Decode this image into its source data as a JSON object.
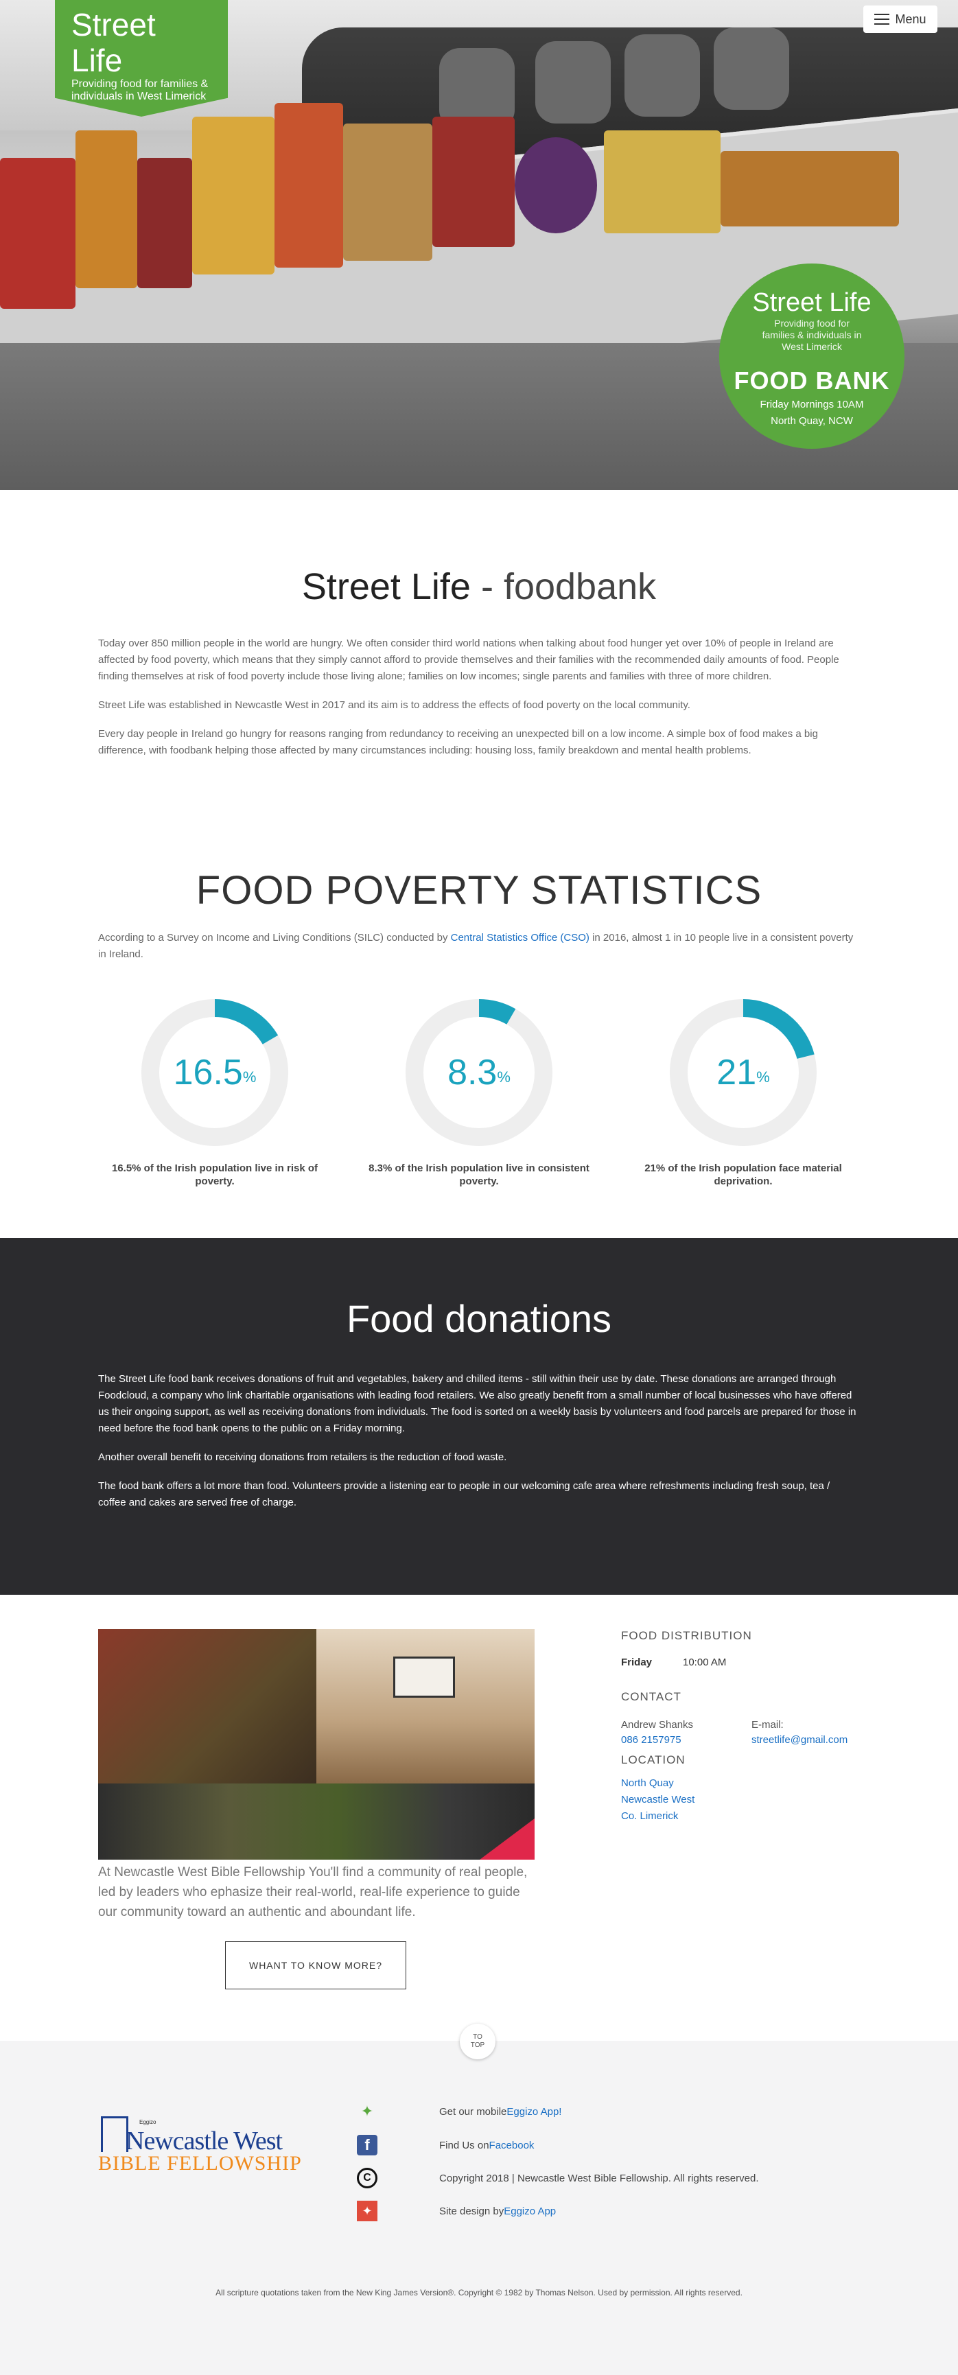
{
  "header": {
    "logo_title": "Street Life",
    "logo_subtitle": "Providing food for families & individuals in West Limerick",
    "menu_label": "Menu"
  },
  "hero_badge": {
    "title": "Street Life",
    "subtitle": "Providing food for families & individuals in West Limerick",
    "headline": "FOOD BANK",
    "line1": "Friday Mornings 10AM",
    "line2": "North Quay, NCW"
  },
  "about": {
    "title_bold": "Street Life",
    "title_light": " - foodbank",
    "paragraphs": [
      "Today over 850 million people in the world are hungry. We often consider third world nations when talking about food hunger yet over 10% of people in Ireland are affected by food poverty, which means that they simply cannot afford to provide themselves and their families with the recommended daily amounts of food. People finding themselves at risk of food poverty include those living alone; families on low incomes; single parents and families with three of more children.",
      "Street Life was established in Newcastle West in 2017 and its aim is to address the effects of food poverty on the local community.",
      "Every day people in Ireland go hungry for reasons ranging from redundancy to receiving an unexpected bill on a low income. A simple box of food makes a big difference, with foodbank helping those affected by many circumstances including: housing loss, family breakdown and mental health problems."
    ]
  },
  "stats": {
    "title": "FOOD POVERTY STATISTICS",
    "intro_before": "According to a Survey on Income and Living Conditions (SILC) conducted by ",
    "intro_link": "Central Statistics Office (CSO)",
    "intro_after": " in 2016, almost 1 in 10 people live in a consistent poverty in Ireland.",
    "items": [
      {
        "value": "16.5",
        "percent": 16.5,
        "unit": "%",
        "caption": "16.5% of the Irish population live in risk of poverty."
      },
      {
        "value": "8.3",
        "percent": 8.3,
        "unit": "%",
        "caption": "8.3% of the Irish population live in consistent poverty."
      },
      {
        "value": "21",
        "percent": 21,
        "unit": "%",
        "caption": "21% of the Irish population face material deprivation."
      }
    ],
    "accent_color": "#1aa3be",
    "track_color": "#eeeeee"
  },
  "donations": {
    "title": "Food donations",
    "paragraphs": [
      "The Street Life food bank receives donations of fruit and vegetables, bakery and chilled items - still within their use by date. These donations are arranged through Foodcloud, a company who link charitable organisations with leading food retailers. We also greatly benefit from a small number of local businesses who have offered us their ongoing support, as well as receiving donations from individuals. The food is sorted on a weekly basis by volunteers and food parcels are prepared for those in need before the food bank opens to the public on a Friday morning.",
      "Another overall benefit to receiving donations from retailers is the reduction of food waste.",
      "The food bank offers a lot more than food. Volunteers provide a listening ear to people in our welcoming cafe area where refreshments including fresh soup, tea / coffee and cakes are served free of charge."
    ]
  },
  "info": {
    "caption": "At Newcastle West Bible Fellowship You'll find a community of real people, led by leaders who ephasize their real-world, real-life experience to guide our community toward an authentic and aboundant life.",
    "more_button": "WHANT TO KNOW MORE?",
    "distribution_heading": "FOOD DISTRIBUTION",
    "day": "Friday",
    "time": "10:00 AM",
    "contact_heading": "CONTACT",
    "contact_name": "Andrew Shanks",
    "contact_phone": "086 2157975",
    "email_label": "E-mail:",
    "email": "streetlife@gmail.com",
    "location_heading": "LOCATION",
    "location_lines": [
      "North Quay",
      "Newcastle West",
      "Co. Limerick"
    ],
    "to_top_1": "TO",
    "to_top_2": "TOP"
  },
  "footer": {
    "logo_main": "Newcastle West",
    "logo_sub": "BIBLE FELLOWSHIP",
    "logo_small": "Eggizo",
    "app_text": "Get our mobile ",
    "app_link": "Eggizo App!",
    "fb_text": "Find Us on ",
    "fb_link": "Facebook",
    "copyright": "Copyright 2018 | Newcastle West Bible Fellowship. All rights reserved.",
    "design_text": "Site design by ",
    "design_link": "Eggizo App",
    "footnote": "All scripture quotations taken from the New King James Version®. Copyright © 1982 by Thomas Nelson. Used by permission. All rights reserved."
  }
}
